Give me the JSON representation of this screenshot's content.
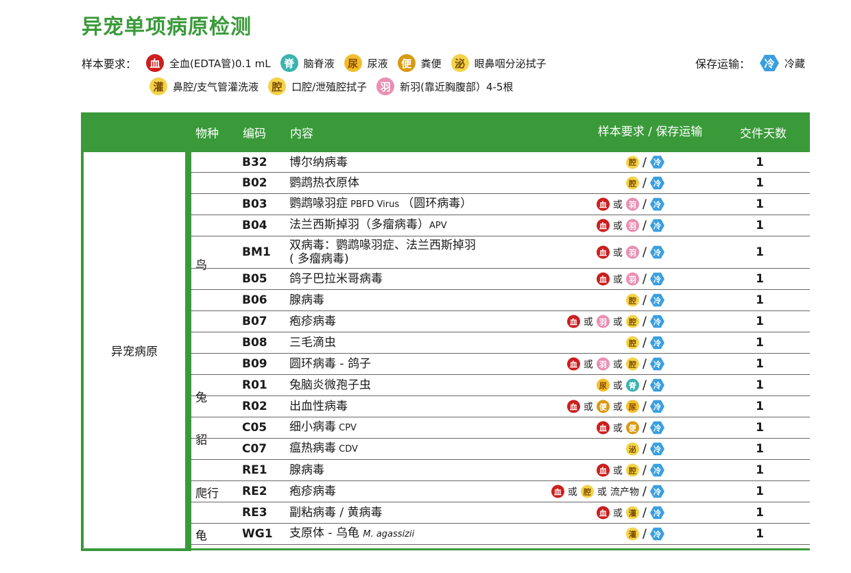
{
  "title": "异宠单项病原检测",
  "sample_requirements": {
    "label": "样本要求：",
    "items_row1": [
      {
        "glyph": "血",
        "kind": "blood",
        "text": "全血(EDTA管)0.1 mL"
      },
      {
        "glyph": "脊",
        "kind": "csf",
        "text": "脑脊液"
      },
      {
        "glyph": "尿",
        "kind": "urine",
        "text": "尿液"
      },
      {
        "glyph": "便",
        "kind": "feces",
        "text": "粪便"
      },
      {
        "glyph": "泌",
        "kind": "swab",
        "text": "眼鼻咽分泌拭子"
      }
    ],
    "items_row2": [
      {
        "glyph": "灌",
        "kind": "lavage",
        "text": "鼻腔/支气管灌洗液"
      },
      {
        "glyph": "腔",
        "kind": "cavity",
        "text": "口腔/泄殖腔拭子"
      },
      {
        "glyph": "羽",
        "kind": "feather",
        "text": "新羽(靠近胸腹部）4-5根"
      }
    ]
  },
  "storage": {
    "label": "保存运输：",
    "glyph": "冷",
    "text": "冷藏"
  },
  "table": {
    "headers": {
      "species": "物种",
      "code": "编码",
      "content": "内容",
      "sample": "样本要求 / 保存运输",
      "days": "交件天数"
    },
    "category": "异宠病原",
    "species_groups": [
      {
        "name": "鸟"
      },
      {
        "name": "兔"
      },
      {
        "name": "貂"
      },
      {
        "name": "爬行"
      },
      {
        "name": "龟"
      }
    ],
    "or_text": "或",
    "slash": "/",
    "rows": [
      {
        "code": "B32",
        "content": "博尔纳病毒",
        "content_en": "",
        "samples": [
          "腔"
        ],
        "days": "1"
      },
      {
        "code": "B02",
        "content": "鹦鹉热衣原体",
        "content_en": "",
        "samples": [
          "腔"
        ],
        "days": "1"
      },
      {
        "code": "B03",
        "content": "鹦鹉喙羽症",
        "content_en": " PBFD Virus ",
        "content_tail": "（圆环病毒）",
        "samples": [
          "血",
          "羽"
        ],
        "days": "1"
      },
      {
        "code": "B04",
        "content": "法兰西斯掉羽（多瘤病毒）",
        "content_en": "APV",
        "samples": [
          "血",
          "羽"
        ],
        "days": "1"
      },
      {
        "code": "BM1",
        "content": "双病毒：鹦鹉喙羽症、法兰西斯掉羽",
        "content_line2": "( 多瘤病毒)",
        "samples": [
          "血",
          "羽"
        ],
        "days": "1"
      },
      {
        "code": "B05",
        "content": "鸽子巴拉米哥病毒",
        "content_en": "",
        "samples": [
          "血",
          "羽"
        ],
        "days": "1"
      },
      {
        "code": "B06",
        "content": "腺病毒",
        "content_en": "",
        "samples": [
          "腔"
        ],
        "days": "1"
      },
      {
        "code": "B07",
        "content": "疱疹病毒",
        "content_en": "",
        "samples": [
          "血",
          "羽",
          "腔"
        ],
        "days": "1"
      },
      {
        "code": "B08",
        "content": "三毛滴虫",
        "content_en": "",
        "samples": [
          "腔"
        ],
        "days": "1"
      },
      {
        "code": "B09",
        "content": "圆环病毒 - 鸽子",
        "content_en": "",
        "samples": [
          "血",
          "羽",
          "腔"
        ],
        "days": "1"
      },
      {
        "code": "R01",
        "content": "兔脑炎微孢子虫",
        "content_en": "",
        "samples": [
          "尿",
          "脊"
        ],
        "days": "1"
      },
      {
        "code": "R02",
        "content": "出血性病毒",
        "content_en": "",
        "samples": [
          "血",
          "便",
          "尿"
        ],
        "days": "1"
      },
      {
        "code": "C05",
        "content": "细小病毒",
        "content_en": " CPV",
        "samples": [
          "血",
          "便"
        ],
        "days": "1"
      },
      {
        "code": "C07",
        "content": "瘟热病毒",
        "content_en": " CDV",
        "samples": [
          "泌"
        ],
        "days": "1"
      },
      {
        "code": "RE1",
        "content": "腺病毒",
        "content_en": "",
        "samples": [
          "血",
          "腔"
        ],
        "days": "1"
      },
      {
        "code": "RE2",
        "content": "疱疹病毒",
        "content_en": "",
        "samples": [
          "血",
          "腔",
          "流产物"
        ],
        "days": "1"
      },
      {
        "code": "RE3",
        "content": "副粘病毒 / 黄病毒",
        "content_en": "",
        "samples": [
          "血",
          "灌"
        ],
        "days": "1"
      },
      {
        "code": "WG1",
        "content": "支原体 - 乌龟 ",
        "content_en": "M. agassizii",
        "samples": [
          "灌"
        ],
        "days": "1"
      }
    ]
  }
}
